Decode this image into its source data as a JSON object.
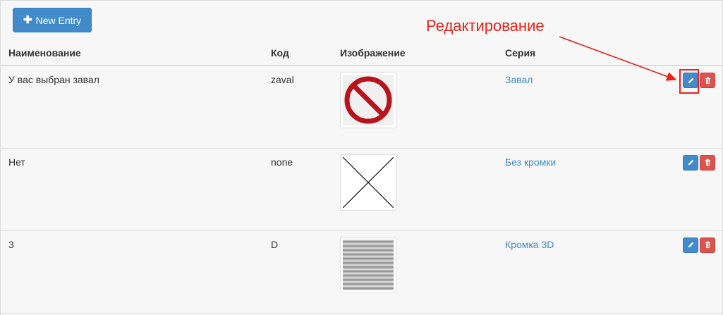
{
  "toolbar": {
    "new_entry_label": "New Entry"
  },
  "table": {
    "headers": {
      "name": "Наименование",
      "code": "Код",
      "image": "Изображение",
      "series": "Серия"
    },
    "rows": [
      {
        "name": "У вас выбран завал",
        "code": "zaval",
        "image_icon": "no-entry-sign-icon",
        "series": "Завал"
      },
      {
        "name": "Нет",
        "code": "none",
        "image_icon": "crossed-box-icon",
        "series": "Без кромки"
      },
      {
        "name": "3",
        "code": "D",
        "image_icon": "striped-texture-icon",
        "series": "Кромка 3D"
      }
    ]
  },
  "annotation": {
    "label": "Редактирование"
  },
  "colors": {
    "primary": "#428bca",
    "danger": "#d9534f",
    "annotation": "#e8231a"
  }
}
